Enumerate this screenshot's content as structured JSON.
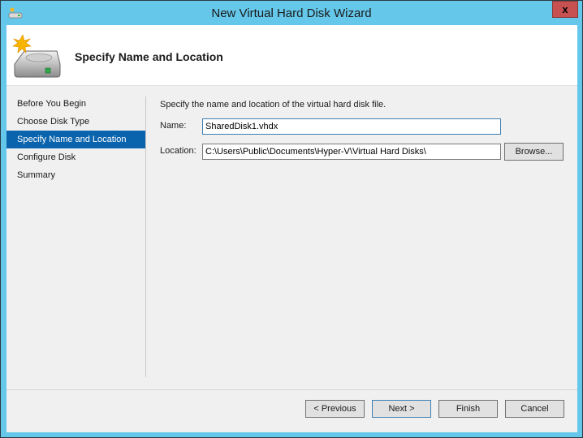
{
  "window": {
    "title": "New Virtual Hard Disk Wizard",
    "close_label": "x"
  },
  "header": {
    "title": "Specify Name and Location",
    "icon": "hard-disk-new-icon"
  },
  "steps": [
    {
      "label": "Before You Begin",
      "active": false
    },
    {
      "label": "Choose Disk Type",
      "active": false
    },
    {
      "label": "Specify Name and Location",
      "active": true
    },
    {
      "label": "Configure Disk",
      "active": false
    },
    {
      "label": "Summary",
      "active": false
    }
  ],
  "content": {
    "description": "Specify the name and location of the virtual hard disk file.",
    "name_label": "Name:",
    "name_value": "SharedDisk1.vhdx",
    "location_label": "Location:",
    "location_value": "C:\\Users\\Public\\Documents\\Hyper-V\\Virtual Hard Disks\\",
    "browse_label": "Browse..."
  },
  "buttons": {
    "previous": "< Previous",
    "next": "Next >",
    "finish": "Finish",
    "cancel": "Cancel"
  },
  "colors": {
    "frame": "#65c8ea",
    "close": "#c75050",
    "selected_step": "#0a64ad"
  }
}
